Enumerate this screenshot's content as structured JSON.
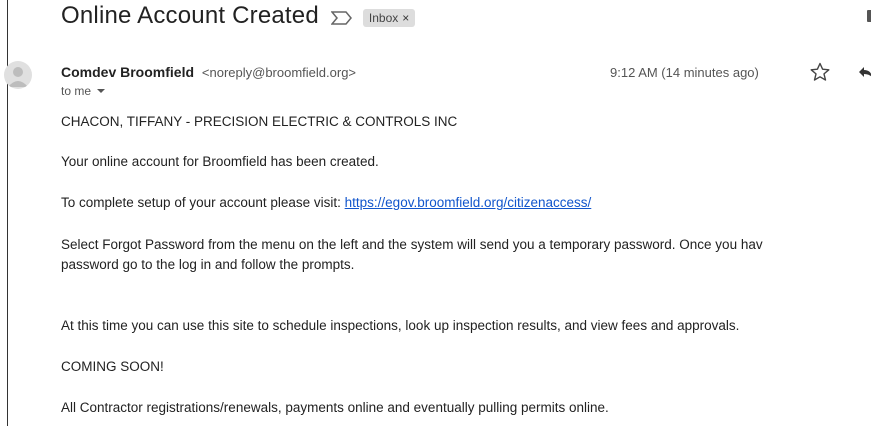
{
  "email": {
    "subject": "Online Account Created",
    "label_chip": "Inbox",
    "chip_close": "×",
    "sender_name": "Comdev Broomfield",
    "sender_email": "<noreply@broomfield.org>",
    "to": "to me",
    "time": "9:12 AM (14 minutes ago)"
  },
  "body": {
    "line1": "CHACON, TIFFANY - PRECISION ELECTRIC & CONTROLS INC",
    "line2": "Your online account for Broomfield has been created.",
    "line3_prefix": "To complete setup of your account please visit: ",
    "line3_link": "https://egov.broomfield.org/citizenaccess/",
    "line4a": "Select Forgot Password from the menu on the left and the system will send you a temporary password. Once you hav",
    "line4b": "password go to the log in and follow the prompts.",
    "line5": "At this time you can use this site to schedule inspections, look up inspection results, and view fees and approvals.",
    "line6": "COMING SOON!",
    "line7": "All Contractor registrations/renewals, payments online and eventually pulling permits online."
  },
  "colors": {
    "link": "#1155cc",
    "chip_bg": "#dddddd",
    "text": "#222222",
    "muted": "#555555"
  }
}
